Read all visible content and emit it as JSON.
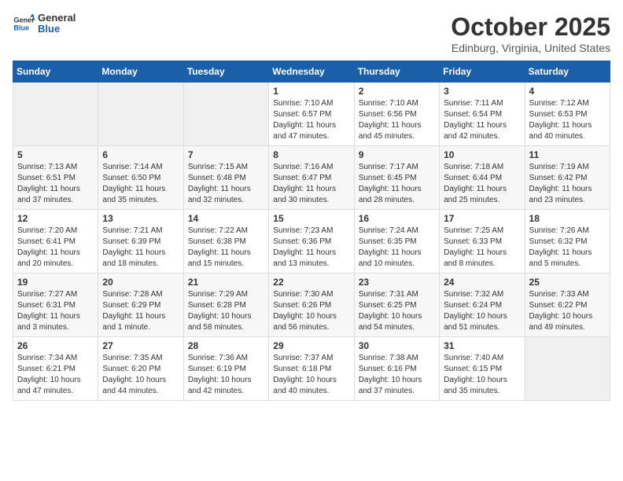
{
  "header": {
    "logo_general": "General",
    "logo_blue": "Blue",
    "month": "October 2025",
    "location": "Edinburg, Virginia, United States"
  },
  "days_of_week": [
    "Sunday",
    "Monday",
    "Tuesday",
    "Wednesday",
    "Thursday",
    "Friday",
    "Saturday"
  ],
  "weeks": [
    [
      {
        "day": "",
        "empty": true
      },
      {
        "day": "",
        "empty": true
      },
      {
        "day": "",
        "empty": true
      },
      {
        "day": "1",
        "sunrise": "7:10 AM",
        "sunset": "6:57 PM",
        "daylight": "11 hours and 47 minutes."
      },
      {
        "day": "2",
        "sunrise": "7:10 AM",
        "sunset": "6:56 PM",
        "daylight": "11 hours and 45 minutes."
      },
      {
        "day": "3",
        "sunrise": "7:11 AM",
        "sunset": "6:54 PM",
        "daylight": "11 hours and 42 minutes."
      },
      {
        "day": "4",
        "sunrise": "7:12 AM",
        "sunset": "6:53 PM",
        "daylight": "11 hours and 40 minutes."
      }
    ],
    [
      {
        "day": "5",
        "sunrise": "7:13 AM",
        "sunset": "6:51 PM",
        "daylight": "11 hours and 37 minutes."
      },
      {
        "day": "6",
        "sunrise": "7:14 AM",
        "sunset": "6:50 PM",
        "daylight": "11 hours and 35 minutes."
      },
      {
        "day": "7",
        "sunrise": "7:15 AM",
        "sunset": "6:48 PM",
        "daylight": "11 hours and 32 minutes."
      },
      {
        "day": "8",
        "sunrise": "7:16 AM",
        "sunset": "6:47 PM",
        "daylight": "11 hours and 30 minutes."
      },
      {
        "day": "9",
        "sunrise": "7:17 AM",
        "sunset": "6:45 PM",
        "daylight": "11 hours and 28 minutes."
      },
      {
        "day": "10",
        "sunrise": "7:18 AM",
        "sunset": "6:44 PM",
        "daylight": "11 hours and 25 minutes."
      },
      {
        "day": "11",
        "sunrise": "7:19 AM",
        "sunset": "6:42 PM",
        "daylight": "11 hours and 23 minutes."
      }
    ],
    [
      {
        "day": "12",
        "sunrise": "7:20 AM",
        "sunset": "6:41 PM",
        "daylight": "11 hours and 20 minutes."
      },
      {
        "day": "13",
        "sunrise": "7:21 AM",
        "sunset": "6:39 PM",
        "daylight": "11 hours and 18 minutes."
      },
      {
        "day": "14",
        "sunrise": "7:22 AM",
        "sunset": "6:38 PM",
        "daylight": "11 hours and 15 minutes."
      },
      {
        "day": "15",
        "sunrise": "7:23 AM",
        "sunset": "6:36 PM",
        "daylight": "11 hours and 13 minutes."
      },
      {
        "day": "16",
        "sunrise": "7:24 AM",
        "sunset": "6:35 PM",
        "daylight": "11 hours and 10 minutes."
      },
      {
        "day": "17",
        "sunrise": "7:25 AM",
        "sunset": "6:33 PM",
        "daylight": "11 hours and 8 minutes."
      },
      {
        "day": "18",
        "sunrise": "7:26 AM",
        "sunset": "6:32 PM",
        "daylight": "11 hours and 5 minutes."
      }
    ],
    [
      {
        "day": "19",
        "sunrise": "7:27 AM",
        "sunset": "6:31 PM",
        "daylight": "11 hours and 3 minutes."
      },
      {
        "day": "20",
        "sunrise": "7:28 AM",
        "sunset": "6:29 PM",
        "daylight": "11 hours and 1 minute."
      },
      {
        "day": "21",
        "sunrise": "7:29 AM",
        "sunset": "6:28 PM",
        "daylight": "10 hours and 58 minutes."
      },
      {
        "day": "22",
        "sunrise": "7:30 AM",
        "sunset": "6:26 PM",
        "daylight": "10 hours and 56 minutes."
      },
      {
        "day": "23",
        "sunrise": "7:31 AM",
        "sunset": "6:25 PM",
        "daylight": "10 hours and 54 minutes."
      },
      {
        "day": "24",
        "sunrise": "7:32 AM",
        "sunset": "6:24 PM",
        "daylight": "10 hours and 51 minutes."
      },
      {
        "day": "25",
        "sunrise": "7:33 AM",
        "sunset": "6:22 PM",
        "daylight": "10 hours and 49 minutes."
      }
    ],
    [
      {
        "day": "26",
        "sunrise": "7:34 AM",
        "sunset": "6:21 PM",
        "daylight": "10 hours and 47 minutes."
      },
      {
        "day": "27",
        "sunrise": "7:35 AM",
        "sunset": "6:20 PM",
        "daylight": "10 hours and 44 minutes."
      },
      {
        "day": "28",
        "sunrise": "7:36 AM",
        "sunset": "6:19 PM",
        "daylight": "10 hours and 42 minutes."
      },
      {
        "day": "29",
        "sunrise": "7:37 AM",
        "sunset": "6:18 PM",
        "daylight": "10 hours and 40 minutes."
      },
      {
        "day": "30",
        "sunrise": "7:38 AM",
        "sunset": "6:16 PM",
        "daylight": "10 hours and 37 minutes."
      },
      {
        "day": "31",
        "sunrise": "7:40 AM",
        "sunset": "6:15 PM",
        "daylight": "10 hours and 35 minutes."
      },
      {
        "day": "",
        "empty": true
      }
    ]
  ]
}
